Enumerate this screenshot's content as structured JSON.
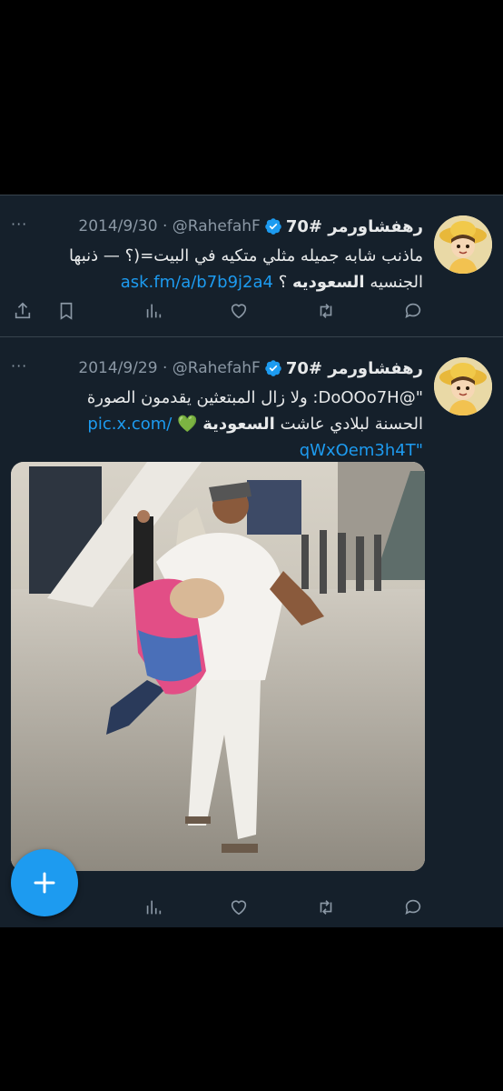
{
  "tweets": [
    {
      "name": "رهفشاورمر #70",
      "handle": "@RahefahF",
      "date": "2014/9/30",
      "more": "···",
      "lines": [
        {
          "plain": "ماذنب شابه جميله مثلي متكيه في البيت=(؟ — ذنبها"
        },
        {
          "prefix": "الجنسيه ",
          "bold": "السعوديه",
          "suffix": " ؟ ",
          "link": "ask.fm/a/b7b9j2a4"
        }
      ]
    },
    {
      "name": "رهفشاورمر #70",
      "handle": "@RahefahF",
      "date": "2014/9/29",
      "more": "···",
      "lines": [
        {
          "plain": "\"@DoOOo7H: ولا زال المبتعثين يقدمون الصورة"
        },
        {
          "prefix": "الحسنة لبلادي عاشت ",
          "bold": "السعودية",
          "emoji": "💚",
          "link": "pic.x.com/"
        },
        {
          "link": "qWxOem3h4T\""
        }
      ],
      "media_alt": "photo"
    }
  ],
  "icons": {
    "reply": "reply-icon",
    "retweet": "retweet-icon",
    "like": "heart-icon",
    "views": "views-icon",
    "bookmark": "bookmark-icon",
    "share": "share-icon",
    "compose": "plus-icon"
  },
  "colors": {
    "background": "#15202b",
    "accent": "#1d9bf0",
    "muted": "#8b98a5",
    "text": "#e7e9ea"
  }
}
